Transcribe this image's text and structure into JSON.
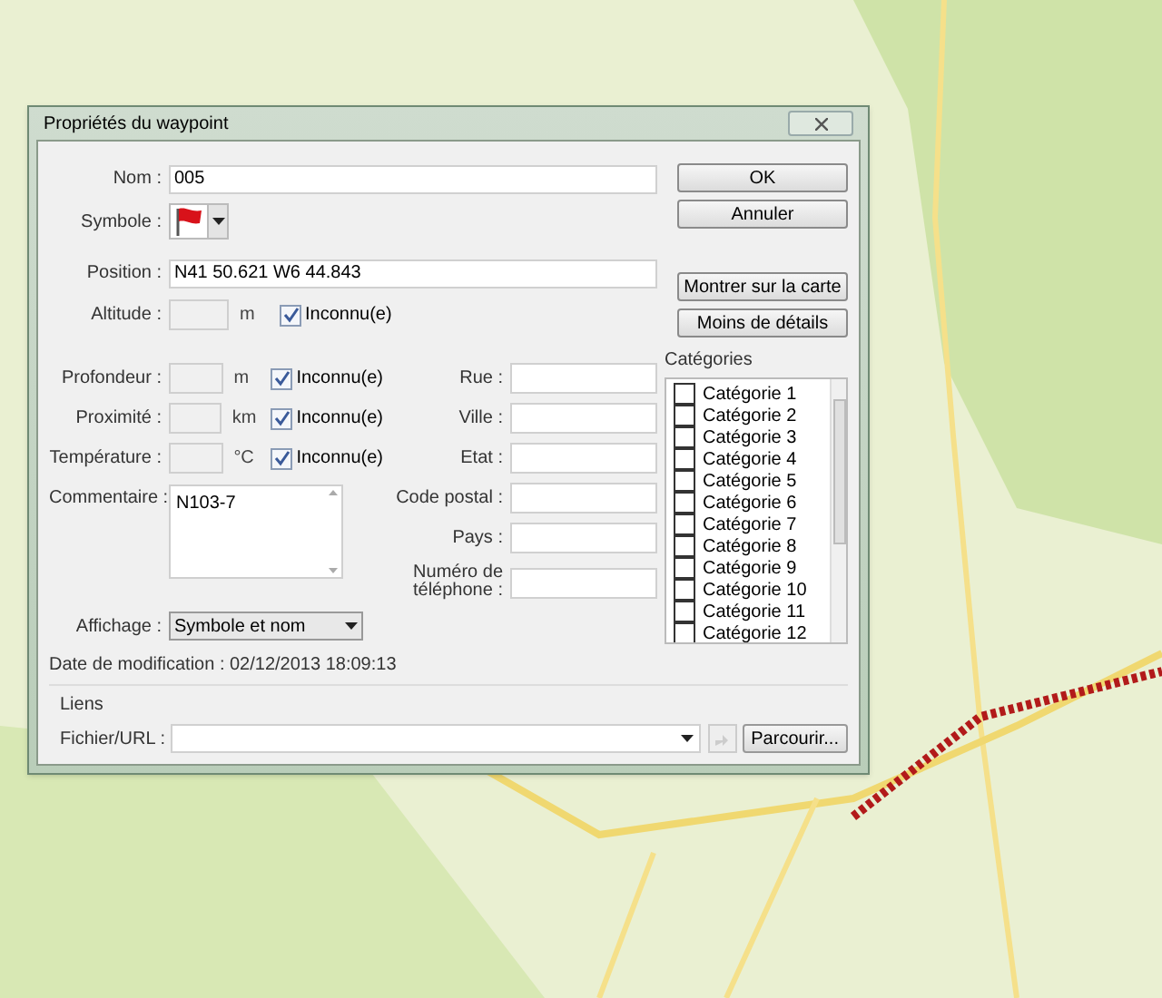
{
  "window": {
    "title": "Propriétés du waypoint"
  },
  "name": {
    "label": "Nom :",
    "value": "005"
  },
  "symbol": {
    "label": "Symbole :"
  },
  "position": {
    "label": "Position :",
    "value": "N41 50.621 W6 44.843"
  },
  "measures": [
    {
      "label": "Altitude :",
      "unit": "m",
      "unknown_label": "Inconnu(e)",
      "unknown_checked": true
    },
    {
      "label": "Profondeur :",
      "unit": "m",
      "unknown_label": "Inconnu(e)",
      "unknown_checked": true
    },
    {
      "label": "Proximité :",
      "unit": "km",
      "unknown_label": "Inconnu(e)",
      "unknown_checked": true
    },
    {
      "label": "Température :",
      "unit": "°C",
      "unknown_label": "Inconnu(e)",
      "unknown_checked": true
    }
  ],
  "comment": {
    "label": "Commentaire :",
    "value": "N103-7"
  },
  "display": {
    "label": "Affichage :",
    "value": "Symbole et nom"
  },
  "modified": "Date de modification : 02/12/2013 18:09:13",
  "address": [
    {
      "label": "Rue :"
    },
    {
      "label": "Ville :"
    },
    {
      "label": "Etat :"
    },
    {
      "label": "Code postal :"
    },
    {
      "label": "Pays :"
    },
    {
      "label": "Numéro de téléphone :"
    }
  ],
  "buttons": [
    {
      "label": "OK"
    },
    {
      "label": "Annuler"
    },
    {
      "label": "Montrer sur la carte"
    },
    {
      "label": "Moins de détails"
    }
  ],
  "categories": {
    "label": "Catégories",
    "items": [
      {
        "label": "Catégorie 1",
        "checked": false
      },
      {
        "label": "Catégorie 2",
        "checked": false
      },
      {
        "label": "Catégorie 3",
        "checked": false
      },
      {
        "label": "Catégorie 4",
        "checked": false
      },
      {
        "label": "Catégorie 5",
        "checked": false
      },
      {
        "label": "Catégorie 6",
        "checked": false
      },
      {
        "label": "Catégorie 7",
        "checked": false
      },
      {
        "label": "Catégorie 8",
        "checked": false
      },
      {
        "label": "Catégorie 9",
        "checked": false
      },
      {
        "label": "Catégorie 10",
        "checked": false
      },
      {
        "label": "Catégorie 11",
        "checked": false
      },
      {
        "label": "Catégorie 12",
        "checked": false
      }
    ]
  },
  "links": {
    "title": "Liens",
    "label": "Fichier/URL :",
    "browse": "Parcourir..."
  }
}
